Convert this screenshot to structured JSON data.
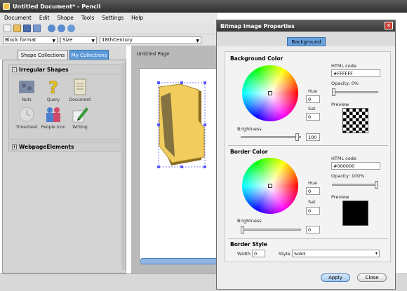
{
  "app": {
    "title": "Untitled Document* - Pencil"
  },
  "menu": [
    "Document",
    "Edit",
    "Shape",
    "Tools",
    "Settings",
    "Help"
  ],
  "toolbar": {
    "font_combo": "Block format",
    "size_combo": "Size",
    "century_combo": "18thCentury"
  },
  "left_tabs": [
    "Shape Collections",
    "My Collections"
  ],
  "collections": {
    "section1_title": "Irregular Shapes",
    "shapes": [
      "Nuts",
      "Query",
      "Document",
      "Timesheet",
      "People Icon",
      "Writing"
    ],
    "section2_title": "WebpageElements"
  },
  "canvas": {
    "page_tab": "Untitled Page"
  },
  "dialog": {
    "title": "Bitmap Image Properties",
    "tab": "Background",
    "background": {
      "title": "Background Color",
      "html_code_label": "HTML code",
      "html_code": "#FFFFFF",
      "opacity_label": "Opacity: 0%",
      "hue_label": "Hue",
      "hue": "0",
      "sat_label": "Sat",
      "sat": "0",
      "preview_label": "Preview",
      "brightness_label": "Brightness",
      "brightness": "100"
    },
    "border": {
      "title": "Border Color",
      "html_code_label": "HTML code",
      "html_code": "#000000",
      "opacity_label": "Opacity: 100%",
      "hue_label": "Hue",
      "hue": "0",
      "sat_label": "Sat",
      "sat": "0",
      "preview_label": "Preview",
      "brightness_label": "Brightness",
      "brightness": "0"
    },
    "border_style": {
      "title": "Border Style",
      "width_label": "Width",
      "width": "0",
      "style_label": "Style",
      "style": "Solid"
    },
    "apply": "Apply",
    "close": "Close"
  },
  "colors": {
    "accent": "#5b9ad8",
    "folder": "#f2cc5c",
    "selection": "#5b5bff"
  }
}
